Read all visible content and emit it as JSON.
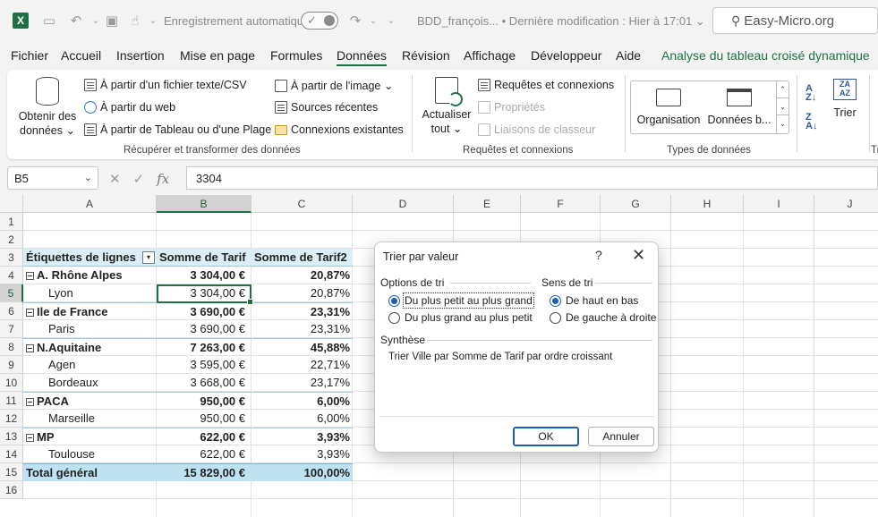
{
  "window": {
    "app_logo": "X",
    "autosave_label": "Enregistrement automatique",
    "autosave_state": "✓",
    "doc_title": "BDD_françois...  •  Dernière modification : Hier à 17:01  ⌄",
    "search_text": "Easy-Micro.org"
  },
  "menu": {
    "tabs": [
      "Fichier",
      "Accueil",
      "Insertion",
      "Mise en page",
      "Formules",
      "Données",
      "Révision",
      "Affichage",
      "Développeur",
      "Aide"
    ],
    "contextual_tab": "Analyse du tableau croisé dynamique",
    "active": "Données"
  },
  "ribbon": {
    "get_data": "Obtenir des données ⌄",
    "from_text": "À partir d'un fichier texte/CSV",
    "from_web": "À partir du web",
    "from_table": "À partir de Tableau ou d'une Plage",
    "from_image": "À partir de l'image ⌄",
    "recent_sources": "Sources récentes",
    "existing_connections": "Connexions existantes",
    "group1": "Récupérer et transformer des données",
    "refresh_all": "Actualiser tout ⌄",
    "queries_connections": "Requêtes et connexions",
    "properties": "Propriétés",
    "edit_links": "Liaisons de classeur",
    "group2": "Requêtes et connexions",
    "organisation": "Organisation",
    "data_b": "Données b...",
    "group3": "Types de données",
    "sort": "Trier",
    "group4_partial": "Tr"
  },
  "formula_bar": {
    "name_box": "B5",
    "value": "3304"
  },
  "grid": {
    "columns": [
      "A",
      "B",
      "C",
      "D",
      "E",
      "F",
      "G",
      "H",
      "I",
      "J"
    ],
    "rows": [
      "1",
      "2",
      "3",
      "4",
      "5",
      "6",
      "7",
      "8",
      "9",
      "10",
      "11",
      "12",
      "13",
      "14",
      "15",
      "16"
    ],
    "selected_column": "B",
    "selected_row": "5"
  },
  "pivot": {
    "header": [
      "Étiquettes de lignes",
      "Somme de Tarif",
      "Somme de Tarif2"
    ],
    "rows": [
      {
        "label": "A. Rhône Alpes",
        "tarif": "3 304,00 €",
        "pct": "20,87%",
        "level": 0
      },
      {
        "label": "Lyon",
        "tarif": "3 304,00 €",
        "pct": "20,87%",
        "level": 1
      },
      {
        "label": "Ile de France",
        "tarif": "3 690,00 €",
        "pct": "23,31%",
        "level": 0
      },
      {
        "label": "Paris",
        "tarif": "3 690,00 €",
        "pct": "23,31%",
        "level": 1
      },
      {
        "label": "N.Aquitaine",
        "tarif": "7 263,00 €",
        "pct": "45,88%",
        "level": 0
      },
      {
        "label": "Agen",
        "tarif": "3 595,00 €",
        "pct": "22,71%",
        "level": 1
      },
      {
        "label": "Bordeaux",
        "tarif": "3 668,00 €",
        "pct": "23,17%",
        "level": 1
      },
      {
        "label": "PACA",
        "tarif": "950,00 €",
        "pct": "6,00%",
        "level": 0
      },
      {
        "label": "Marseille",
        "tarif": "950,00 €",
        "pct": "6,00%",
        "level": 1
      },
      {
        "label": "MP",
        "tarif": "622,00 €",
        "pct": "3,93%",
        "level": 0
      },
      {
        "label": "Toulouse",
        "tarif": "622,00 €",
        "pct": "3,93%",
        "level": 1
      }
    ],
    "total": {
      "label": "Total général",
      "tarif": "15 829,00 €",
      "pct": "100,00%"
    }
  },
  "dialog": {
    "title": "Trier par valeur",
    "help": "?",
    "close": "✕",
    "sort_options_title": "Options de tri",
    "opt_ascending": "Du plus petit au plus grand",
    "opt_descending": "Du plus grand au plus petit",
    "direction_title": "Sens de tri",
    "dir_top_bottom": "De haut en bas",
    "dir_left_right": "De gauche à droite",
    "summary_title": "Synthèse",
    "summary_text": "Trier Ville par Somme de Tarif par ordre croissant",
    "ok": "OK",
    "cancel": "Annuler"
  }
}
